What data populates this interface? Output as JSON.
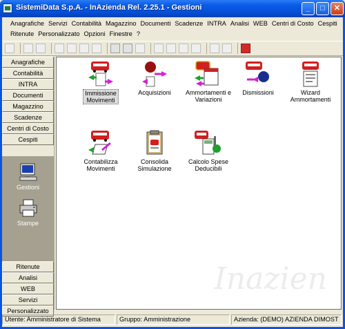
{
  "window": {
    "title": "SistemiData S.p.A. - InAzienda Rel. 2.25.1 - Gestioni",
    "controls": {
      "minimize": "_",
      "maximize": "□",
      "close": "✕"
    }
  },
  "menu": {
    "row1": [
      "Anagrafiche",
      "Servizi",
      "Contabilità",
      "Magazzino",
      "Documenti",
      "Scadenze",
      "INTRA",
      "Analisi",
      "WEB",
      "Centri di Costo",
      "Cespiti"
    ],
    "row2": [
      "Ritenute",
      "Personalizzato",
      "Opzioni",
      "Finestre",
      "?"
    ]
  },
  "sidebar": {
    "top": [
      "Anagrafiche",
      "Contabilità",
      "INTRA",
      "Documenti",
      "Magazzino",
      "Scadenze",
      "Centri di Costo",
      "Cespiti"
    ],
    "panel": [
      "Gestioni",
      "Stampe"
    ],
    "bottom": [
      "Ritenute",
      "Analisi",
      "WEB",
      "Servizi",
      "Personalizzato"
    ]
  },
  "apps": [
    {
      "line1": "Immissione",
      "line2": "Movimenti"
    },
    {
      "line1": "Acquisizioni",
      "line2": ""
    },
    {
      "line1": "Ammortamenti e",
      "line2": "Variazioni"
    },
    {
      "line1": "Dismissioni",
      "line2": ""
    },
    {
      "line1": "Wizard",
      "line2": "Ammortamenti"
    },
    {
      "line1": "Contabilizza",
      "line2": "Movimenti"
    },
    {
      "line1": "Consolida",
      "line2": "Simulazione"
    },
    {
      "line1": "Calcolo Spese",
      "line2": "Deducibili"
    }
  ],
  "watermark": "Inazien",
  "status": {
    "user": "Utente: Amministratore di Sistema",
    "group": "Gruppo: Amministrazione",
    "company": "Azienda: (DEMO) AZIENDA DIMOST"
  },
  "colors": {
    "titlebar": "#0a5ce8",
    "bus_red": "#d21f1f",
    "arrow_green": "#1fa02c",
    "arrow_magenta": "#d81ed8",
    "panel": "#a5a08f"
  }
}
